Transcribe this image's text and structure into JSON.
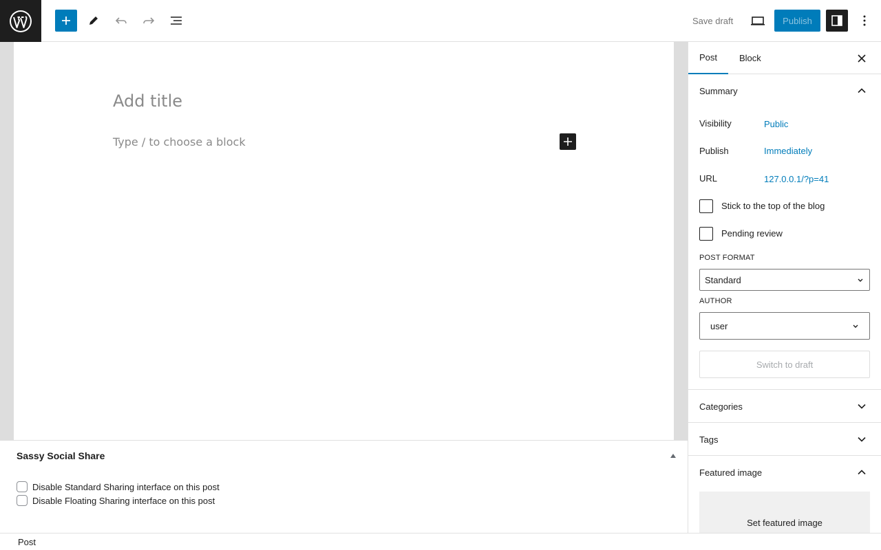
{
  "topbar": {
    "save_draft": "Save draft",
    "publish": "Publish"
  },
  "editor": {
    "title_placeholder": "Add title",
    "block_placeholder": "Type / to choose a block"
  },
  "metabox": {
    "title": "Sassy Social Share",
    "options": [
      {
        "label": "Disable Standard Sharing interface on this post",
        "checked": false
      },
      {
        "label": "Disable Floating Sharing interface on this post",
        "checked": false
      }
    ]
  },
  "statusbar": {
    "label": "Post"
  },
  "sidebar": {
    "tabs": [
      "Post",
      "Block"
    ],
    "active_tab": "Post",
    "summary": {
      "title": "Summary",
      "visibility_label": "Visibility",
      "visibility_value": "Public",
      "publish_label": "Publish",
      "publish_value": "Immediately",
      "url_label": "URL",
      "url_value": "127.0.0.1/?p=41",
      "stick_label": "Stick to the top of the blog",
      "pending_label": "Pending review",
      "post_format_label": "POST FORMAT",
      "post_format_value": "Standard",
      "author_label": "AUTHOR",
      "author_value": "user",
      "switch_to_draft": "Switch to draft"
    },
    "categories": "Categories",
    "tags": "Tags",
    "featured_image": "Featured image",
    "set_featured_image": "Set featured image"
  },
  "colors": {
    "accent": "#007cba",
    "dark": "#1e1e1e"
  }
}
